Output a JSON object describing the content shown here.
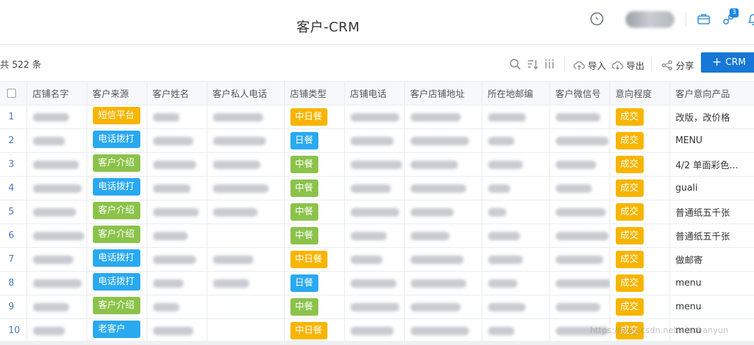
{
  "header": {
    "title": "客户-CRM",
    "notification_badge": "3",
    "icons": [
      "compass-icon",
      "briefcase-icon",
      "links-icon",
      "bell-icon"
    ]
  },
  "toolbar": {
    "total_text": "共 522 条",
    "import_label": "导入",
    "export_label": "导出",
    "share_label": "分享",
    "add_crm_label": "CRM",
    "add_icon": "+"
  },
  "colors": {
    "accent": "#1677d6",
    "source_sms": "#f7b500",
    "source_phone": "#29a9f0",
    "source_referral": "#8bc34a",
    "source_old": "#29a9f0",
    "type_chinese_japanese": "#f7b500",
    "type_japanese": "#29a9f0",
    "type_chinese": "#8bc34a",
    "intent_deal": "#f7b500"
  },
  "table": {
    "columns": [
      "店铺名字",
      "客户来源",
      "客户姓名",
      "客户私人电话",
      "店铺类型",
      "店铺电话",
      "客户店铺地址",
      "所在地邮编",
      "客户微信号",
      "意向程度",
      "客户意向产品"
    ],
    "rows": [
      {
        "num": "1",
        "source": "短信平台",
        "source_color": "#f7b500",
        "shop_type": "中日餐",
        "type_color": "#f7b500",
        "intent": "成交",
        "product": "改版，改价格",
        "has_private_phone": true
      },
      {
        "num": "2",
        "source": "电话拨打",
        "source_color": "#29a9f0",
        "shop_type": "日餐",
        "type_color": "#29a9f0",
        "intent": "成交",
        "product": "MENU",
        "has_private_phone": true
      },
      {
        "num": "3",
        "source": "客户介绍",
        "source_color": "#8bc34a",
        "shop_type": "中餐",
        "type_color": "#8bc34a",
        "intent": "成交",
        "product": "4/2 单面彩色…",
        "has_private_phone": true
      },
      {
        "num": "4",
        "source": "电话拨打",
        "source_color": "#29a9f0",
        "shop_type": "中餐",
        "type_color": "#8bc34a",
        "intent": "成交",
        "product": "guali",
        "has_private_phone": true
      },
      {
        "num": "5",
        "source": "客户介绍",
        "source_color": "#8bc34a",
        "shop_type": "中餐",
        "type_color": "#8bc34a",
        "intent": "成交",
        "product": "普通纸五千张",
        "has_private_phone": true
      },
      {
        "num": "6",
        "source": "客户介绍",
        "source_color": "#8bc34a",
        "shop_type": "中餐",
        "type_color": "#8bc34a",
        "intent": "成交",
        "product": "普通纸五千张",
        "has_private_phone": false
      },
      {
        "num": "7",
        "source": "电话拨打",
        "source_color": "#29a9f0",
        "shop_type": "中日餐",
        "type_color": "#f7b500",
        "intent": "成交",
        "product": "做邮寄",
        "has_private_phone": true
      },
      {
        "num": "8",
        "source": "电话拨打",
        "source_color": "#29a9f0",
        "shop_type": "日餐",
        "type_color": "#29a9f0",
        "intent": "成交",
        "product": "menu",
        "has_private_phone": true
      },
      {
        "num": "9",
        "source": "客户介绍",
        "source_color": "#8bc34a",
        "shop_type": "中餐",
        "type_color": "#8bc34a",
        "intent": "成交",
        "product": "menu",
        "has_private_phone": false
      },
      {
        "num": "10",
        "source": "老客户",
        "source_color": "#29a9f0",
        "shop_type": "中日餐",
        "type_color": "#f7b500",
        "intent": "成交",
        "product": "menu",
        "has_private_phone": false
      }
    ]
  },
  "watermark": "https://blog.csdn.net/xiaobanyun"
}
